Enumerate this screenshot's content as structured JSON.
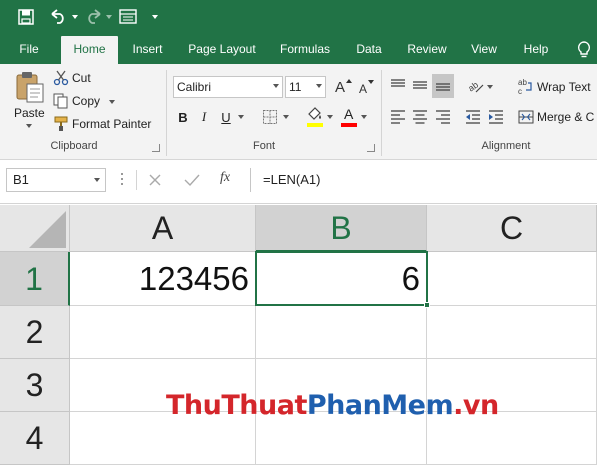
{
  "tabs": [
    {
      "label": "File"
    },
    {
      "label": "Home"
    },
    {
      "label": "Insert"
    },
    {
      "label": "Page Layout"
    },
    {
      "label": "Formulas"
    },
    {
      "label": "Data"
    },
    {
      "label": "Review"
    },
    {
      "label": "View"
    },
    {
      "label": "Help"
    }
  ],
  "active_tab": "Home",
  "clipboard": {
    "paste_label": "Paste",
    "cut_label": "Cut",
    "copy_label": "Copy",
    "format_painter_label": "Format Painter",
    "group_label": "Clipboard"
  },
  "font": {
    "font_name": "Calibri",
    "font_size": "11",
    "bold": "B",
    "italic": "I",
    "underline": "U",
    "grow_glyph": "A",
    "shrink_glyph": "A",
    "font_color_glyph": "A",
    "group_label": "Font",
    "font_color": "#ff0000",
    "highlight_color": "#ffff00"
  },
  "alignment": {
    "wrap_text_label": "Wrap Text",
    "merge_label": "Merge & C",
    "group_label": "Alignment"
  },
  "formula_bar": {
    "name_box": "B1",
    "fx_label": "fx",
    "formula": "=LEN(A1)"
  },
  "sheet": {
    "columns": [
      "A",
      "B",
      "C"
    ],
    "rows": [
      "1",
      "2",
      "3",
      "4"
    ],
    "cells": {
      "A1": "123456",
      "B1": "6"
    },
    "selected_cell": "B1"
  },
  "watermark": {
    "part1": "ThuThuat",
    "part2": "PhanMem",
    "part3": ".vn"
  },
  "colors": {
    "excel_green": "#217346",
    "ribbon_bg": "#f3f3f3",
    "header_bg": "#e6e6e6"
  }
}
